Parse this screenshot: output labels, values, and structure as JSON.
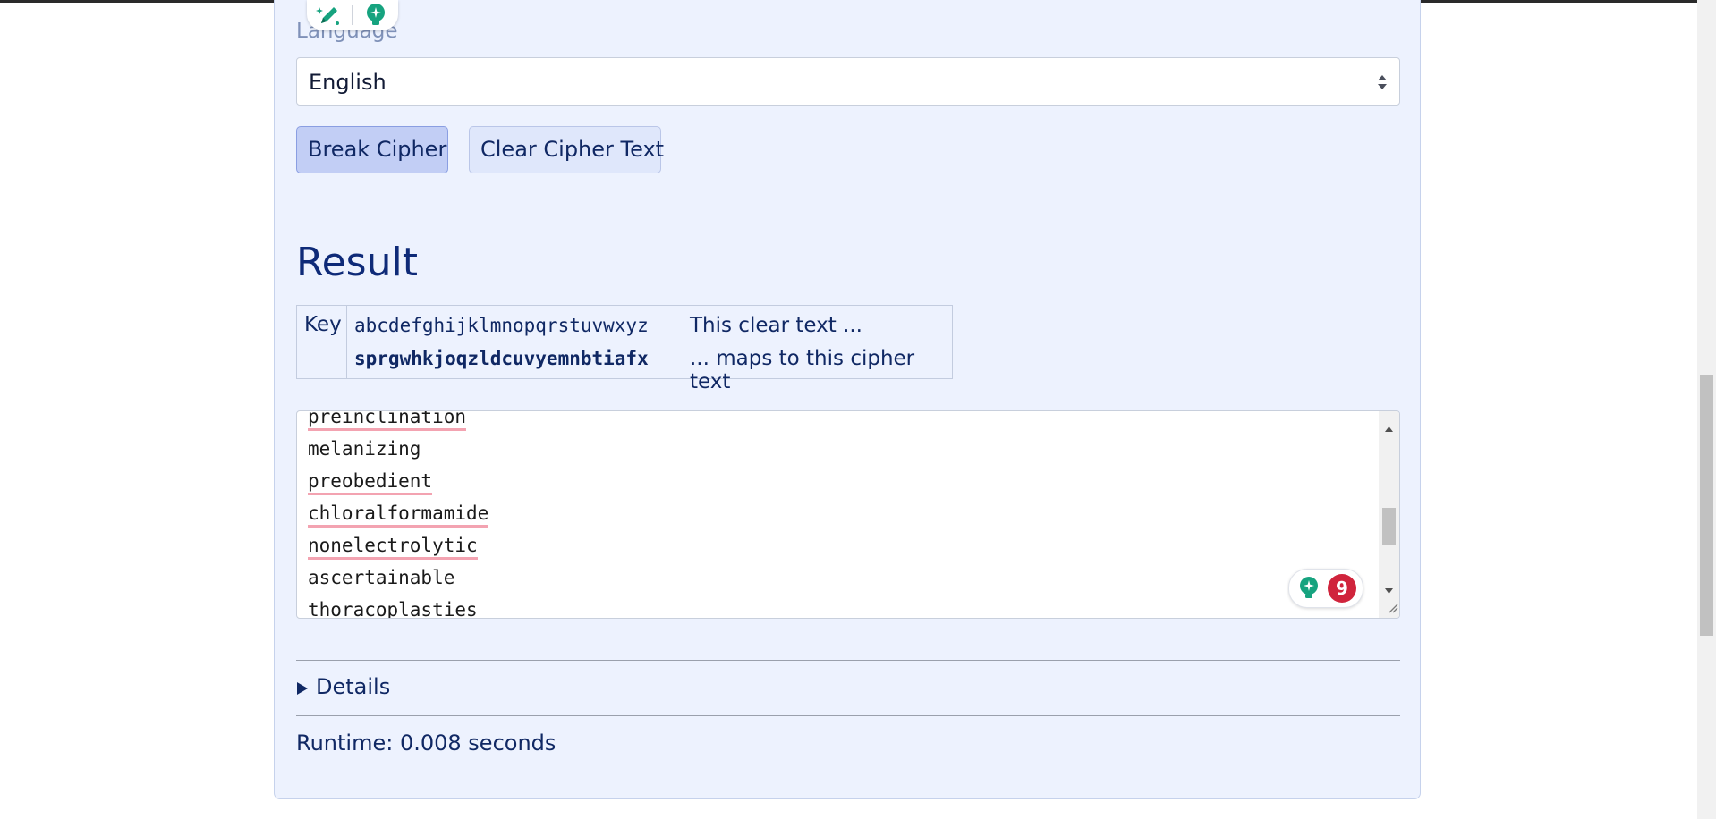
{
  "language": {
    "label": "Language",
    "selected": "English"
  },
  "buttons": {
    "break_cipher": "Break Cipher",
    "clear_cipher_text": "Clear Cipher Text"
  },
  "result": {
    "heading": "Result",
    "key": {
      "label": "Key",
      "clear_alphabet": "abcdefghijklmnopqrstuvwxyz",
      "cipher_alphabet": "sprgwhkjoqzldcuvyemnbtiafx",
      "clear_text_desc": "This clear text ...",
      "cipher_text_desc": "... maps to this cipher text"
    },
    "output_lines": [
      "preinclination",
      "melanizing",
      "preobedient",
      "chloralformamide",
      "nonelectrolytic",
      "ascertainable",
      "thoracoplasties"
    ]
  },
  "grammar_badge": {
    "count": "9"
  },
  "details": {
    "label": "Details"
  },
  "runtime": {
    "text": "Runtime: 0.008 seconds"
  },
  "colors": {
    "card_background": "#edf2fe",
    "primary_text": "#102864",
    "heading": "#0e2a78",
    "spell_underline": "#f3a3b1",
    "badge_red": "#d0243c",
    "extension_green": "#16a37f"
  },
  "icons": {
    "tools": [
      "pencil-sparkle-icon",
      "lightbulb-sparkle-icon"
    ],
    "select": "sort-arrows-icon",
    "details": "triangle-right-icon",
    "badge": "lightbulb-sparkle-icon"
  }
}
